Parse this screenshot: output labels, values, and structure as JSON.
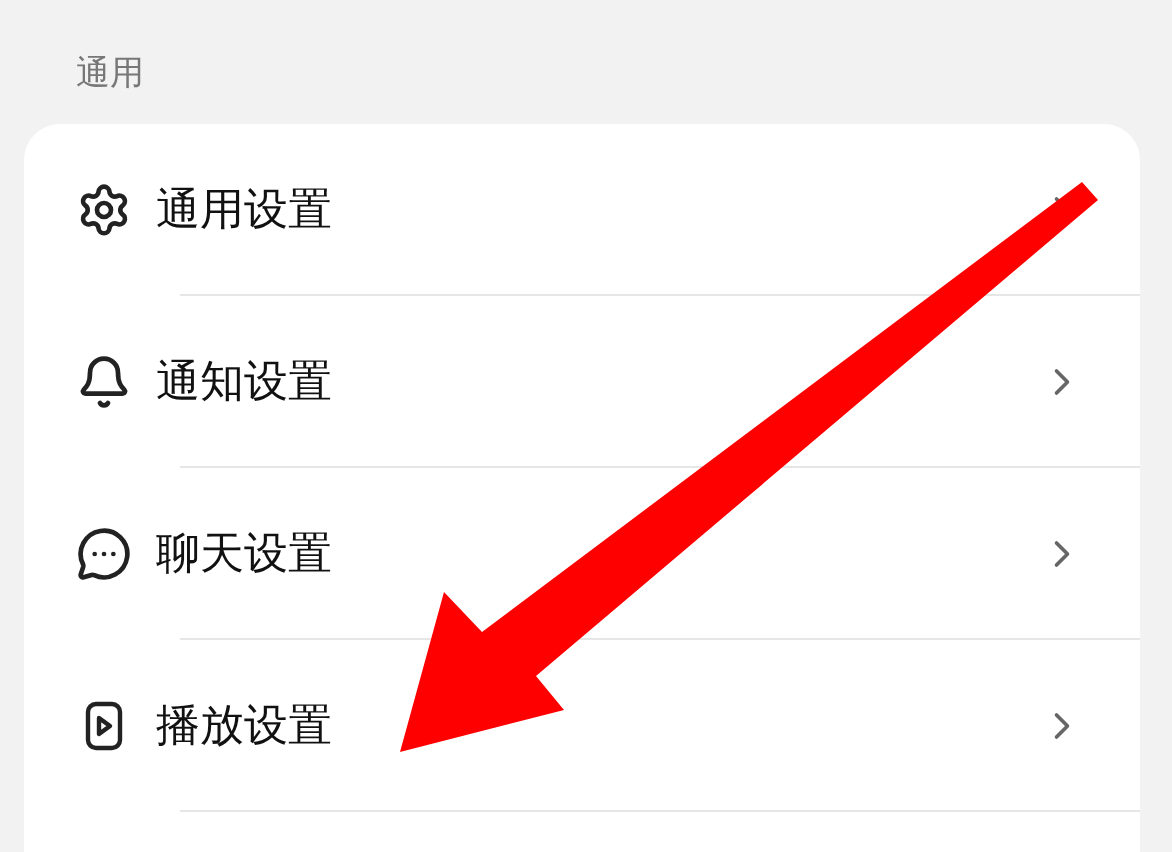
{
  "section": {
    "title": "通用"
  },
  "items": [
    {
      "label": "通用设置"
    },
    {
      "label": "通知设置"
    },
    {
      "label": "聊天设置"
    },
    {
      "label": "播放设置"
    }
  ]
}
